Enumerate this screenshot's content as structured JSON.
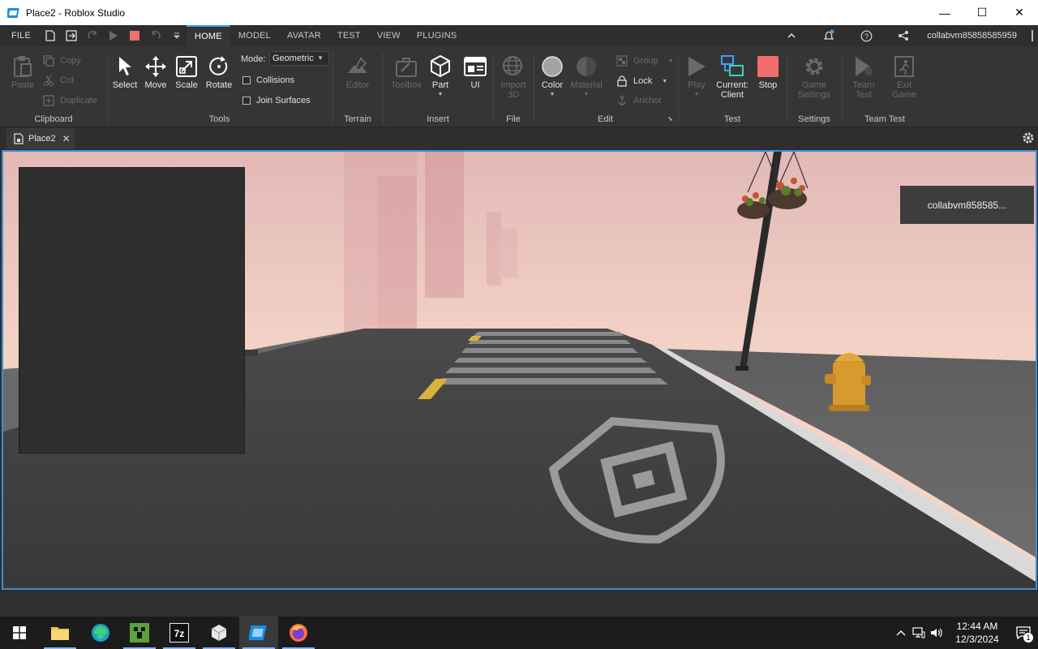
{
  "window": {
    "title": "Place2 - Roblox Studio",
    "minimize": "—",
    "maximize": "☐",
    "close": "✕"
  },
  "menu": {
    "file": "FILE",
    "tabs": [
      "HOME",
      "MODEL",
      "AVATAR",
      "TEST",
      "VIEW",
      "PLUGINS"
    ],
    "active_tab": "HOME",
    "username": "collabvm85858585959"
  },
  "ribbon": {
    "clipboard": {
      "label": "Clipboard",
      "paste": "Paste",
      "copy": "Copy",
      "cut": "Cut",
      "duplicate": "Duplicate"
    },
    "tools": {
      "label": "Tools",
      "select": "Select",
      "move": "Move",
      "scale": "Scale",
      "rotate": "Rotate",
      "mode_label": "Mode:",
      "mode_value": "Geometric",
      "collisions": "Collisions",
      "join_surfaces": "Join Surfaces"
    },
    "terrain": {
      "label": "Terrain",
      "editor": "Editor"
    },
    "insert": {
      "label": "Insert",
      "toolbox": "Toolbox",
      "part": "Part",
      "ui": "UI"
    },
    "file": {
      "label": "File",
      "import_3d_line1": "Import",
      "import_3d_line2": "3D"
    },
    "edit": {
      "label": "Edit",
      "color": "Color",
      "material": "Material",
      "group": "Group",
      "lock": "Lock",
      "anchor": "Anchor"
    },
    "test": {
      "label": "Test",
      "play": "Play",
      "current_line1": "Current:",
      "current_line2": "Client",
      "stop": "Stop"
    },
    "settings": {
      "label": "Settings",
      "game_settings_line1": "Game",
      "game_settings_line2": "Settings"
    },
    "team_test": {
      "label": "Team Test",
      "team_test_line1": "Team",
      "team_test_line2": "Test",
      "exit_game_line1": "Exit",
      "exit_game_line2": "Game"
    }
  },
  "document": {
    "tab": "Place2",
    "close": "✕"
  },
  "viewport": {
    "player_tag": "collabvm858585..."
  },
  "taskbar": {
    "apps": [
      "file-explorer",
      "edge",
      "minecraft",
      "7zip",
      "roblox-player",
      "roblox-studio",
      "firefox"
    ],
    "time": "12:44 AM",
    "date": "12/3/2024",
    "notification_count": "1"
  },
  "colors": {
    "accent": "#3a8fd6",
    "stop_red": "#f26d6d",
    "ribbon_bg": "#353535",
    "sky_top": "#e9c7c2",
    "road": "#3f3f3f"
  }
}
